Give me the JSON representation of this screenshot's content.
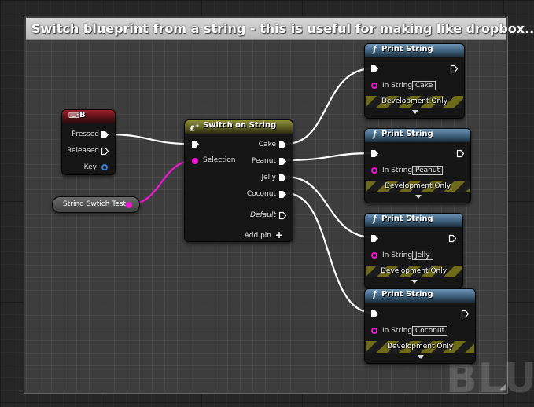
{
  "comment": {
    "title": "Switch blueprint from a string - this is useful for making like dropbox.."
  },
  "watermark": "BLU",
  "colors": {
    "exec_wire": "#ffffff",
    "string_wire": "#f116d6",
    "key_pin": "#3a7bd9",
    "dev_stripe": "#6d6b1a"
  },
  "key_event": {
    "title": "B",
    "icon": "keyboard-icon",
    "pins": {
      "pressed": "Pressed",
      "released": "Released",
      "key": "Key"
    }
  },
  "variable": {
    "label": "String Swtich Test"
  },
  "switch_node": {
    "title": "Switch on String",
    "icon": "switch-icon",
    "selection_label": "Selection",
    "outputs": [
      "Cake",
      "Peanut",
      "Jelly",
      "Coconut"
    ],
    "default_label": "Default",
    "add_pin_label": "Add pin"
  },
  "print_nodes": [
    {
      "title": "Print String",
      "in_string_label": "In String",
      "value": "Cake",
      "dev_label": "Development Only"
    },
    {
      "title": "Print String",
      "in_string_label": "In String",
      "value": "Peanut",
      "dev_label": "Development Only"
    },
    {
      "title": "Print String",
      "in_string_label": "In String",
      "value": "Jelly",
      "dev_label": "Development Only"
    },
    {
      "title": "Print String",
      "in_string_label": "In String",
      "value": "Coconut",
      "dev_label": "Development Only"
    }
  ]
}
